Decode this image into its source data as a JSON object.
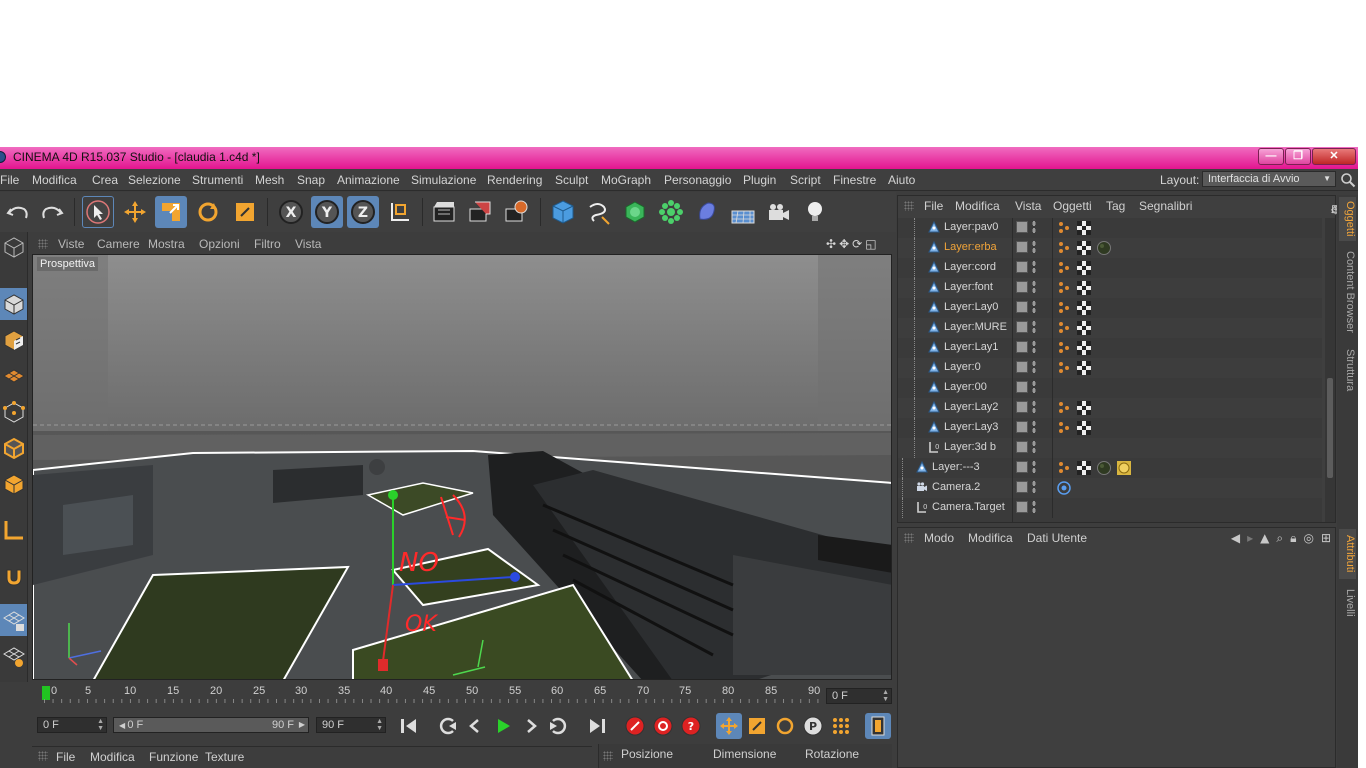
{
  "window": {
    "title": "CINEMA 4D R15.037 Studio - [claudia 1.c4d *]",
    "minimize": "—",
    "maximize": "❐",
    "close": "✕"
  },
  "menubar": {
    "items": [
      "File",
      "Modifica",
      "Crea",
      "Selezione",
      "Strumenti",
      "Mesh",
      "Snap",
      "Animazione",
      "Simulazione",
      "Rendering",
      "Sculpt",
      "MoGraph",
      "Personaggio",
      "Plugin",
      "Script",
      "Finestre",
      "Aiuto"
    ],
    "layout_label": "Layout:",
    "layout_value": "Interfaccia di Avvio"
  },
  "toolbar": {
    "icons": [
      "undo-icon",
      "redo-icon",
      "select-arrow-icon",
      "move-icon",
      "scale-icon",
      "rotate-icon",
      "live-selection-icon",
      "x-axis-lock-icon",
      "y-axis-lock-icon",
      "z-axis-lock-icon",
      "coordinate-system-icon",
      "render-view-icon",
      "render-picture-viewer-icon",
      "render-settings-icon",
      "cube-icon",
      "spline-pen-icon",
      "subdivision-icon",
      "array-icon",
      "deformer-icon",
      "floor-icon",
      "camera-icon",
      "light-icon"
    ],
    "axis_labels": [
      "X",
      "Y",
      "Z"
    ]
  },
  "viewport": {
    "menu": [
      "Viste",
      "Camere",
      "Mostra",
      "Opzioni",
      "Filtro",
      "Vista"
    ],
    "label": "Prospettiva",
    "nav_icons": [
      "✣",
      "✥",
      "⟳",
      "◱"
    ],
    "annotations": [
      "NO",
      "OK"
    ]
  },
  "timeline": {
    "ticks": [
      "0",
      "5",
      "10",
      "15",
      "20",
      "25",
      "30",
      "35",
      "40",
      "45",
      "50",
      "55",
      "60",
      "65",
      "70",
      "75",
      "80",
      "85",
      "90"
    ],
    "current_frame": "0 F",
    "start_field": "0 F",
    "range_start": "0 F",
    "range_end": "90 F",
    "end_field": "90 F"
  },
  "transport": {
    "icons": [
      "go-to-start-icon",
      "previous-key-icon",
      "step-back-icon",
      "play-icon",
      "step-forward-icon",
      "next-key-icon",
      "go-to-end-icon",
      "record-icon",
      "autokey-icon",
      "keyframe-selection-icon",
      "move-key-icon",
      "scale-key-icon",
      "rotate-key-icon",
      "param-key-icon",
      "pla-grid-icon",
      "timeline-window-icon"
    ],
    "param_label": "P"
  },
  "material_manager": {
    "menu": [
      "File",
      "Modifica",
      "Funzione",
      "Texture"
    ]
  },
  "coordinates": {
    "columns": [
      "Posizione",
      "Dimensione",
      "Rotazione"
    ]
  },
  "object_manager": {
    "menu": [
      "File",
      "Modifica",
      "Vista",
      "Oggetti",
      "Tag",
      "Segnalibri"
    ],
    "rows": [
      {
        "name": "Layer:pav0",
        "type": "layer",
        "indent": 1,
        "tags": [
          "dots",
          "checker"
        ],
        "selected": false
      },
      {
        "name": "Layer:erba",
        "type": "layer",
        "indent": 1,
        "tags": [
          "dots",
          "checker",
          "sphere-dark"
        ],
        "selected": true
      },
      {
        "name": "Layer:cord",
        "type": "layer",
        "indent": 1,
        "tags": [
          "dots",
          "checker"
        ],
        "selected": false
      },
      {
        "name": "Layer:font",
        "type": "layer",
        "indent": 1,
        "tags": [
          "dots",
          "checker"
        ],
        "selected": false
      },
      {
        "name": "Layer:Lay0",
        "type": "layer",
        "indent": 1,
        "tags": [
          "dots",
          "checker"
        ],
        "selected": false
      },
      {
        "name": "Layer:MURE",
        "type": "layer",
        "indent": 1,
        "tags": [
          "dots",
          "checker"
        ],
        "selected": false
      },
      {
        "name": "Layer:Lay1",
        "type": "layer",
        "indent": 1,
        "tags": [
          "dots",
          "checker"
        ],
        "selected": false
      },
      {
        "name": "Layer:0",
        "type": "layer",
        "indent": 1,
        "tags": [
          "dots",
          "checker"
        ],
        "selected": false
      },
      {
        "name": "Layer:00",
        "type": "layer",
        "indent": 1,
        "tags": [],
        "selected": false
      },
      {
        "name": "Layer:Lay2",
        "type": "layer",
        "indent": 1,
        "tags": [
          "dots",
          "checker"
        ],
        "selected": false
      },
      {
        "name": "Layer:Lay3",
        "type": "layer",
        "indent": 1,
        "tags": [
          "dots",
          "checker"
        ],
        "selected": false
      },
      {
        "name": "Layer:3d b",
        "type": "null",
        "indent": 1,
        "tags": [],
        "selected": false
      },
      {
        "name": "Layer:---3",
        "type": "layer",
        "indent": 0,
        "tags": [
          "dots",
          "checker",
          "sphere-dark",
          "sphere-gold"
        ],
        "selected": false
      },
      {
        "name": "Camera.2",
        "type": "camera",
        "indent": 0,
        "tags": [
          "target"
        ],
        "selected": false
      },
      {
        "name": "Camera.Target",
        "type": "null",
        "indent": 0,
        "tags": [],
        "selected": false
      }
    ]
  },
  "attributes": {
    "menu": [
      "Modo",
      "Modifica",
      "Dati Utente"
    ]
  },
  "side_tabs": {
    "top": [
      "Oggetti",
      "Content Browser",
      "Struttura"
    ],
    "bottom": [
      "Attributi",
      "Livelli"
    ]
  },
  "colors": {
    "titlebar": "#e3148f",
    "accent": "#5d87b8",
    "selected_text": "#f0a43a",
    "playhead": "#21c321"
  }
}
